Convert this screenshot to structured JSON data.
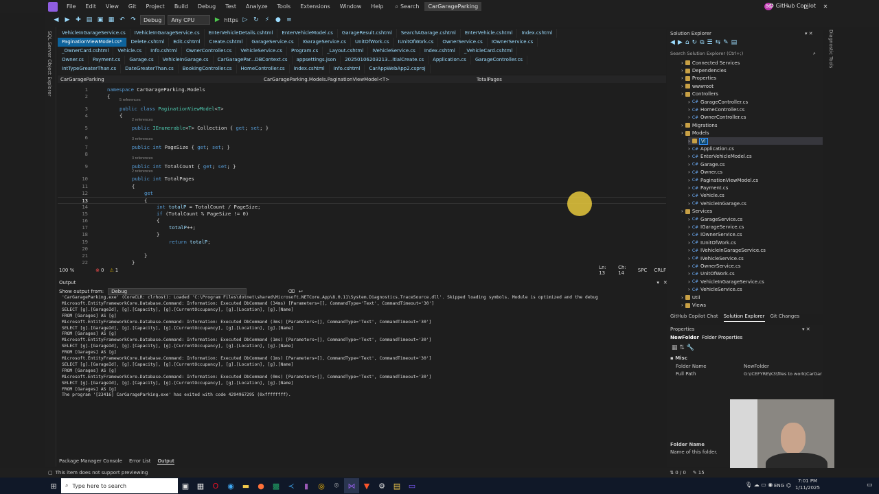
{
  "menubar": {
    "items": [
      "File",
      "Edit",
      "View",
      "Git",
      "Project",
      "Build",
      "Debug",
      "Test",
      "Analyze",
      "Tools",
      "Extensions",
      "Window",
      "Help"
    ],
    "search_label": "Search",
    "project_title": "CarGarageParking",
    "user_initials": "BC",
    "copilot_label": "GitHub Copilot"
  },
  "toolbar": {
    "config": "Debug",
    "platform": "Any CPU",
    "run_target": "https"
  },
  "left_strip": {
    "label": "SQL Server Object Explorer"
  },
  "right_strip": {
    "label": "Diagnostic Tools"
  },
  "tabs": {
    "row1": [
      "VehicleInGarageService.cs",
      "IVehicleInGarageService.cs",
      "EnterVehicleDetails.cshtml",
      "EnterVehicleModel.cs",
      "GarageResult.cshtml",
      "SearchAGarage.cshtml",
      "EnterVehicle.cshtml",
      "Index.cshtml"
    ],
    "row2": [
      "PaginationViewModel.cs*",
      "Delete.cshtml",
      "Edit.cshtml",
      "Create.cshtml",
      "GarageService.cs",
      "IGarageService.cs",
      "UnitOfWork.cs",
      "IUnitOfWork.cs",
      "OwnerService.cs",
      "IOwnerService.cs"
    ],
    "row3": [
      "_OwnerCard.cshtml",
      "Vehicle.cs",
      "Info.cshtml",
      "OwnerController.cs",
      "VehicleService.cs",
      "Program.cs",
      "_Layout.cshtml",
      "IVehicleService.cs",
      "Index.cshtml",
      "_VehicleCard.cshtml"
    ],
    "row4": [
      "Owner.cs",
      "Payment.cs",
      "Garage.cs",
      "VehicleInGarage.cs",
      "CarGaragePar...DBContext.cs",
      "appsettings.json",
      "20250106203213...itialCreate.cs",
      "Application.cs",
      "GarageController.cs"
    ],
    "row5": [
      "IntTypeGreaterThan.cs",
      "DateGreaterThan.cs",
      "BookingController.cs",
      "HomeController.cs",
      "Index.cshtml",
      "Info.cshtml",
      "CarAppWebApp2.csproj"
    ]
  },
  "pathbar": {
    "project": "CarGarageParking",
    "class": "CarGarageParking.Models.PaginationViewModel<T>",
    "member": "TotalPages"
  },
  "code": {
    "refs": {
      "five": "5 references",
      "two": "2 references",
      "three": "3 references"
    },
    "lines": [
      {
        "n": "1",
        "t": "namespace CarGarageParking.Models"
      },
      {
        "n": "2",
        "t": "{"
      },
      {
        "n": "3",
        "t": "public class PaginationViewModel<T>"
      },
      {
        "n": "4",
        "t": "{"
      },
      {
        "n": "5",
        "t": "public IEnumerable<T> Collection { get; set; }"
      },
      {
        "n": "6",
        "t": ""
      },
      {
        "n": "7",
        "t": "public int PageSize { get; set; }"
      },
      {
        "n": "8",
        "t": ""
      },
      {
        "n": "9",
        "t": "public int TotalCount { get; set; }"
      },
      {
        "n": "10",
        "t": "public int TotalPages"
      },
      {
        "n": "11",
        "t": "{"
      },
      {
        "n": "12",
        "t": "get"
      },
      {
        "n": "13",
        "t": "{"
      },
      {
        "n": "14",
        "t": "int totalP = TotalCount / PageSize;"
      },
      {
        "n": "15",
        "t": "if (TotalCount % PageSize != 0)"
      },
      {
        "n": "16",
        "t": "{"
      },
      {
        "n": "17",
        "t": "totalP++;"
      },
      {
        "n": "18",
        "t": "}"
      },
      {
        "n": "19",
        "t": "return totalP;"
      },
      {
        "n": "20",
        "t": ""
      },
      {
        "n": "21",
        "t": "}"
      },
      {
        "n": "22",
        "t": "}"
      }
    ]
  },
  "editor_status": {
    "zoom": "100 %",
    "errors": "0",
    "warnings": "1",
    "ln": "Ln: 13",
    "ch": "Ch: 14",
    "spc": "SPC",
    "crlf": "CRLF"
  },
  "output": {
    "title": "Output",
    "show_from_label": "Show output from:",
    "source": "Debug",
    "lines": [
      "'CarGarageParking.exe' (CoreCLR: clrhost): Loaded 'C:\\Program Files\\dotnet\\shared\\Microsoft.NETCore.App\\8.0.11\\System.Diagnostics.TraceSource.dll'. Skipped loading symbols. Module is optimized and the debug",
      "Microsoft.EntityFrameworkCore.Database.Command: Information: Executed DbCommand (34ms) [Parameters=[], CommandType='Text', CommandTimeout='30']",
      "SELECT [g].[GarageId], [g].[Capacity], [g].[CurrentOccupancy], [g].[Location], [g].[Name]",
      "FROM [Garages] AS [g]",
      "Microsoft.EntityFrameworkCore.Database.Command: Information: Executed DbCommand (3ms) [Parameters=[], CommandType='Text', CommandTimeout='30']",
      "SELECT [g].[GarageId], [g].[Capacity], [g].[CurrentOccupancy], [g].[Location], [g].[Name]",
      "FROM [Garages] AS [g]",
      "Microsoft.EntityFrameworkCore.Database.Command: Information: Executed DbCommand (1ms) [Parameters=[], CommandType='Text', CommandTimeout='30']",
      "SELECT [g].[GarageId], [g].[Capacity], [g].[CurrentOccupancy], [g].[Location], [g].[Name]",
      "FROM [Garages] AS [g]",
      "Microsoft.EntityFrameworkCore.Database.Command: Information: Executed DbCommand (1ms) [Parameters=[], CommandType='Text', CommandTimeout='30']",
      "SELECT [g].[GarageId], [g].[Capacity], [g].[CurrentOccupancy], [g].[Location], [g].[Name]",
      "FROM [Garages] AS [g]",
      "Microsoft.EntityFrameworkCore.Database.Command: Information: Executed DbCommand (0ms) [Parameters=[], CommandType='Text', CommandTimeout='30']",
      "SELECT [g].[GarageId], [g].[Capacity], [g].[CurrentOccupancy], [g].[Location], [g].[Name]",
      "FROM [Garages] AS [g]",
      "The program '[23416] CarGarageParking.exe' has exited with code 4294967295 (0xffffffff)."
    ]
  },
  "bottom_tabs": [
    "Package Manager Console",
    "Error List",
    "Output"
  ],
  "solution": {
    "title": "Solution Explorer",
    "search_placeholder": "Search Solution Explorer (Ctrl+;)",
    "items": [
      {
        "label": "Connected Services",
        "kind": "folder",
        "indent": 1
      },
      {
        "label": "Dependencies",
        "kind": "folder",
        "indent": 1
      },
      {
        "label": "Properties",
        "kind": "folder",
        "indent": 1
      },
      {
        "label": "wwwroot",
        "kind": "folder",
        "indent": 1
      },
      {
        "label": "Controllers",
        "kind": "folder",
        "indent": 1
      },
      {
        "label": "GarageController.cs",
        "kind": "cs",
        "indent": 2
      },
      {
        "label": "HomeController.cs",
        "kind": "cs",
        "indent": 2
      },
      {
        "label": "OwnerController.cs",
        "kind": "cs",
        "indent": 2
      },
      {
        "label": "Migrations",
        "kind": "folder",
        "indent": 1
      },
      {
        "label": "Models",
        "kind": "folder",
        "indent": 1
      },
      {
        "label": "VI",
        "kind": "rename",
        "indent": 2
      },
      {
        "label": "Application.cs",
        "kind": "cs",
        "indent": 2
      },
      {
        "label": "EnterVehicleModel.cs",
        "kind": "cs",
        "indent": 2
      },
      {
        "label": "Garage.cs",
        "kind": "cs",
        "indent": 2
      },
      {
        "label": "Owner.cs",
        "kind": "cs",
        "indent": 2
      },
      {
        "label": "PaginationViewModel.cs",
        "kind": "cs",
        "indent": 2
      },
      {
        "label": "Payment.cs",
        "kind": "cs",
        "indent": 2
      },
      {
        "label": "Vehicle.cs",
        "kind": "cs",
        "indent": 2
      },
      {
        "label": "VehicleInGarage.cs",
        "kind": "cs",
        "indent": 2
      },
      {
        "label": "Services",
        "kind": "folder",
        "indent": 1
      },
      {
        "label": "GarageService.cs",
        "kind": "cs",
        "indent": 2
      },
      {
        "label": "IGarageService.cs",
        "kind": "cs",
        "indent": 2
      },
      {
        "label": "IOwnerService.cs",
        "kind": "cs",
        "indent": 2
      },
      {
        "label": "IUnitOfWork.cs",
        "kind": "cs",
        "indent": 2
      },
      {
        "label": "IVehicleInGarageService.cs",
        "kind": "cs",
        "indent": 2
      },
      {
        "label": "IVehicleService.cs",
        "kind": "cs",
        "indent": 2
      },
      {
        "label": "OwnerService.cs",
        "kind": "cs",
        "indent": 2
      },
      {
        "label": "UnitOfWork.cs",
        "kind": "cs",
        "indent": 2
      },
      {
        "label": "VehicleInGarageService.cs",
        "kind": "cs",
        "indent": 2
      },
      {
        "label": "VehicleService.cs",
        "kind": "cs",
        "indent": 2
      },
      {
        "label": "Util",
        "kind": "folder",
        "indent": 1
      },
      {
        "label": "Views",
        "kind": "folder",
        "indent": 1
      }
    ],
    "tabs": [
      "GitHub Copilot Chat",
      "Solution Explorer",
      "Git Changes"
    ]
  },
  "properties": {
    "title": "Properties",
    "subject": "NewFolder",
    "subject_kind": "Folder Properties",
    "section": "Misc",
    "rows": [
      {
        "name": "Folder Name",
        "value": "NewFolder"
      },
      {
        "name": "Full Path",
        "value": "G:\\ICEFYRE\\K3\\files to work\\CarGar"
      }
    ],
    "desc_title": "Folder Name",
    "desc_text": "Name of this folder."
  },
  "statusbar": {
    "message": "This item does not support previewing",
    "arrows": "0 / 0",
    "pencil_count": "15"
  },
  "taskbar": {
    "search_placeholder": "Type here to search",
    "lang": "ENG",
    "time": "7:01 PM",
    "date": "1/11/2025"
  }
}
